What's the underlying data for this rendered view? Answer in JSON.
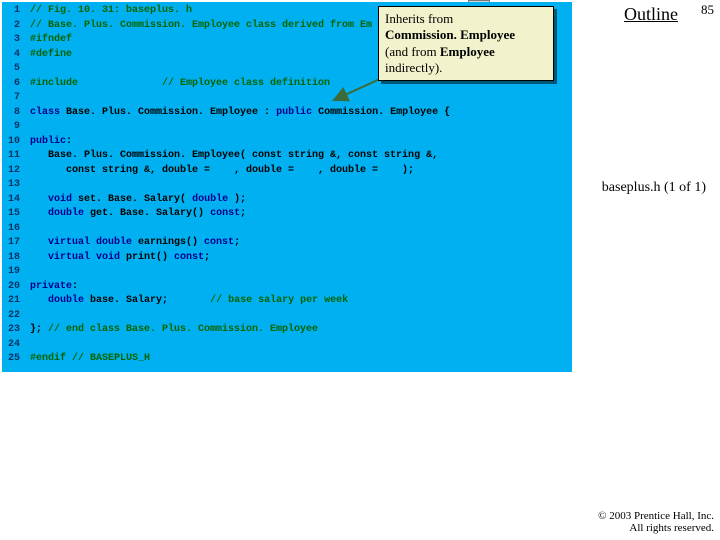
{
  "page_number": "85",
  "outline_link": "Outline",
  "file_label": "baseplus.h (1 of 1)",
  "copyright_line1": "© 2003 Prentice Hall, Inc.",
  "copyright_line2": "All rights reserved.",
  "nav_arrow": "up-arrow-icon",
  "callout": {
    "l1": "Inherits from ",
    "l2a": "Commission. Employee",
    "l3a": "(and from ",
    "l3b": "Employee",
    "l4": "indirectly)."
  },
  "gutter": [
    "1",
    "2",
    "3",
    "4",
    "5",
    "6",
    "7",
    "8",
    "9",
    "10",
    "11",
    "12",
    "13",
    "14",
    "15",
    "16",
    "17",
    "18",
    "19",
    "20",
    "21",
    "22",
    "23",
    "24",
    "25"
  ],
  "code": {
    "l1": "// Fig. 10. 31: baseplus. h",
    "l2": "// Base. Plus. Commission. Employee class derived from Em",
    "l3": "#ifndef",
    "l4": "#define",
    "l5": "",
    "l6a": "#include",
    "l6b": "              ",
    "l6c": "// Employee class definition",
    "l7": "",
    "l8a": "class",
    "l8b": " Base. Plus. Commission. Employee : ",
    "l8c": "public",
    "l8d": " Commission. Employee {",
    "l9": "",
    "l10a": "public",
    "l10b": ":",
    "l11": "   Base. Plus. Commission. Employee( const string &, const string &,",
    "l12": "      const string &, double =    , double =    , double =    );",
    "l13": "",
    "l14a": "   ",
    "l14b": "void",
    "l14c": " set. Base. Salary( ",
    "l14d": "double",
    "l14e": " );",
    "l15a": "   ",
    "l15b": "double",
    "l15c": " get. Base. Salary() ",
    "l15d": "const",
    "l15e": ";",
    "l16": "",
    "l17a": "   ",
    "l17b": "virtual double",
    "l17c": " earnings() ",
    "l17d": "const",
    "l17e": ";",
    "l18a": "   ",
    "l18b": "virtual void",
    "l18c": " print() ",
    "l18d": "const",
    "l18e": ";",
    "l19": "",
    "l20a": "private",
    "l20b": ":",
    "l21a": "   ",
    "l21b": "double",
    "l21c": " base. Salary;       ",
    "l21d": "// base salary per week",
    "l22": "",
    "l23a": "}; ",
    "l23b": "// end class Base. Plus. Commission. Employee",
    "l24": "",
    "l25a": "#endif",
    "l25b": " // BASEPLUS_H"
  }
}
